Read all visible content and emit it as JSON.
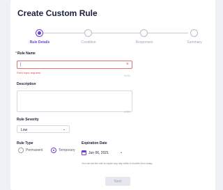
{
  "title": "Create Custom Rule",
  "steps": [
    {
      "label": "Rule Details",
      "active": true
    },
    {
      "label": "Condition",
      "active": false
    },
    {
      "label": "Responses",
      "active": false
    },
    {
      "label": "Summary",
      "active": false
    }
  ],
  "rule_name": {
    "label": "Rule Name",
    "required_marker": "*",
    "value": "|",
    "error": "Field input required",
    "counter": "0/100",
    "clear_icon": "close-icon"
  },
  "description": {
    "label": "Description",
    "counter": "0/300"
  },
  "severity": {
    "label": "Rule Severity",
    "value": "Low"
  },
  "rule_type": {
    "label": "Rule Type",
    "options": [
      "Permanent",
      "Temporary"
    ],
    "selected": "Temporary"
  },
  "expiration": {
    "label": "Expiration Date",
    "value": "Jun 06, 2021",
    "hint": "You can set the rule to expire any day within 6 months from today."
  },
  "actions": {
    "next": "Next"
  },
  "colors": {
    "accent": "#6a3fd1",
    "error": "#d94a4a",
    "background": "#eef0f6"
  }
}
